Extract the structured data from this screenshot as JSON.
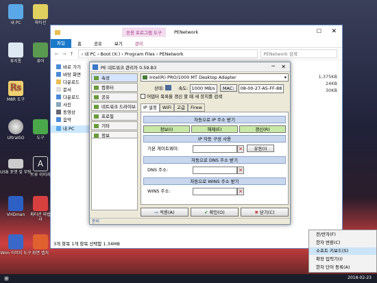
{
  "desktop": {
    "icons": [
      {
        "name": "desktop-icon-mypc",
        "label": "내 PC",
        "x": 0,
        "y": 0
      },
      {
        "name": "desktop-icon-recycle",
        "label": "휴지통"
      },
      {
        "name": "desktop-icon-m8r",
        "label": "M8R 도구"
      },
      {
        "name": "desktop-icon-ultraiso",
        "label": "UltraISO"
      },
      {
        "name": "desktop-icon-usb",
        "label": "USB 포맷 및 부팅"
      },
      {
        "name": "desktop-icon-vhdman",
        "label": "VHDman"
      },
      {
        "name": "desktop-icon-wim",
        "label": "Wim 이미지 도구"
      }
    ],
    "icons2": [
      {
        "name": "desktop-icon-p2",
        "label": "파티션"
      },
      {
        "name": "desktop-icon-p3",
        "label": "퓨어"
      },
      {
        "name": "desktop-icon-p4",
        "label": "도구"
      },
      {
        "name": "desktop-icon-p5",
        "label": "트루 이미지"
      },
      {
        "name": "desktop-icon-p6",
        "label": "파티션 마법사"
      },
      {
        "name": "desktop-icon-p7",
        "label": "화면 캡처"
      }
    ]
  },
  "explorer": {
    "context_tab": "응용 프로그램 도구",
    "title": "PENetwork",
    "tabs": [
      "파일",
      "홈",
      "공유",
      "보기",
      "관리"
    ],
    "path": "› 내 PC › Boot (X:) › Program Files › PENetwork",
    "search": "PENetwork 검색",
    "nav": [
      "바로 가기",
      "바탕 화면",
      "다운로드",
      "문서",
      "다운로드",
      "사진",
      "동영상",
      "음악",
      "내 PC"
    ],
    "sizes": [
      "1,375KB",
      "24KB",
      "30KB"
    ],
    "status": "3개 항목    1개 항목 선택함 1.34MB"
  },
  "pe": {
    "title": "PE 네트워크 관리자 0.59.B3",
    "side": [
      "속성",
      "컴퓨터",
      "공유",
      "네트워크 드라이브",
      "프로필",
      "기타",
      "정보"
    ],
    "adapter": "Intel(R) PRO/1000 MT Desktop Adapter",
    "state_label": "상태:",
    "speed_label": "속도:",
    "speed": "1000 MB/s",
    "mac_label": "MAC:",
    "mac": "08-00-27-A5-FF-88",
    "checkbox": "어댑터 목록을 갱신 할 때 새 장치를 검색",
    "tabs": [
      "IP 설정",
      "WiFi",
      "고급",
      "Firew"
    ],
    "ip_header": "자동으로 IP 주소 받기",
    "ip_buttons": [
      "정보(I)",
      "해제(E)",
      "갱신(R)"
    ],
    "static_header": "IP 자동 구성 사용",
    "gateway_label": "기본 게이트웨이:",
    "priority_btn": "유동(I)",
    "dns_header": "자동으로 DNS 주소 받기",
    "dns_label": "DNS 주소:",
    "wins_header": "자동으로 WINS 주소 받기",
    "wins_label": "WINS 주소:",
    "apply": "적용(A)",
    "ok": "확인(O)",
    "close": "닫기(C)",
    "status": "준비"
  },
  "ctx": {
    "items": [
      "전/반자(F)",
      "한자 변환(C)",
      "소프트 키보드(S)",
      "확장 입력기(I)",
      "한자 단어 등록(A)"
    ]
  },
  "taskbar": {
    "date": "2018-02-23"
  }
}
